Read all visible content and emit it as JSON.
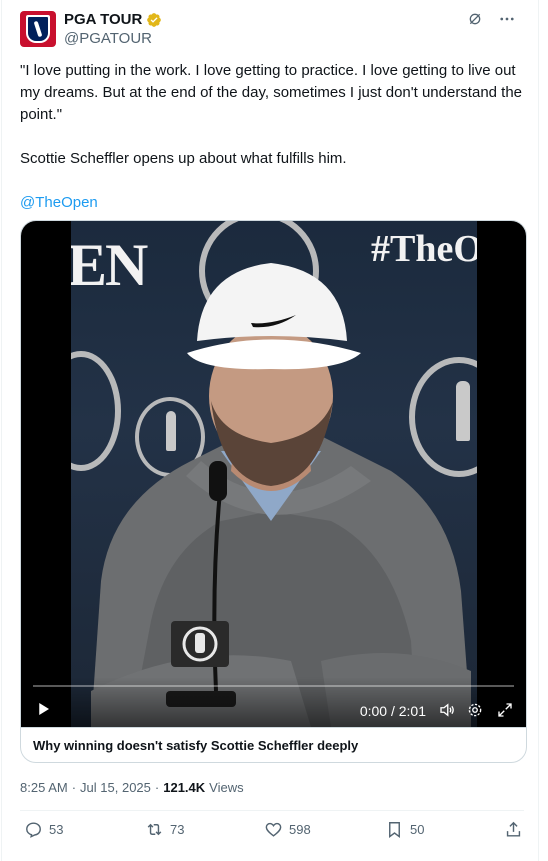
{
  "author": {
    "display_name": "PGA TOUR",
    "handle": "@PGATOUR",
    "verified_icon": "gold-verified-badge-icon",
    "avatar_label": "PGA TOUR"
  },
  "top_actions": {
    "grok_icon": "grok-icon",
    "more_icon": "more-icon"
  },
  "tweet": {
    "quote_line": "\"I love putting in the work. I love getting to practice. I love getting to live out my dreams. But at the end of the day, sometimes I just don't understand the point.\"",
    "body_line": "Scottie Scheffler opens up about what fulfills him.",
    "mention": "@TheOpen"
  },
  "media": {
    "background_text_left": "EN",
    "background_text_right": "#TheO",
    "time_display": "0:00 / 2:01",
    "caption": "Why winning doesn't satisfy Scottie Scheffler deeply",
    "progress": 0
  },
  "meta": {
    "time": "8:25 AM",
    "separator1": "·",
    "date": "Jul 15, 2025",
    "separator2": "·",
    "views_count": "121.4K",
    "views_label": "Views"
  },
  "actions": {
    "replies": "53",
    "reposts": "73",
    "likes": "598",
    "bookmarks": "50"
  },
  "colors": {
    "accent": "#1d9bf0",
    "verified_gold": "#e2b719",
    "muted": "#536471"
  }
}
